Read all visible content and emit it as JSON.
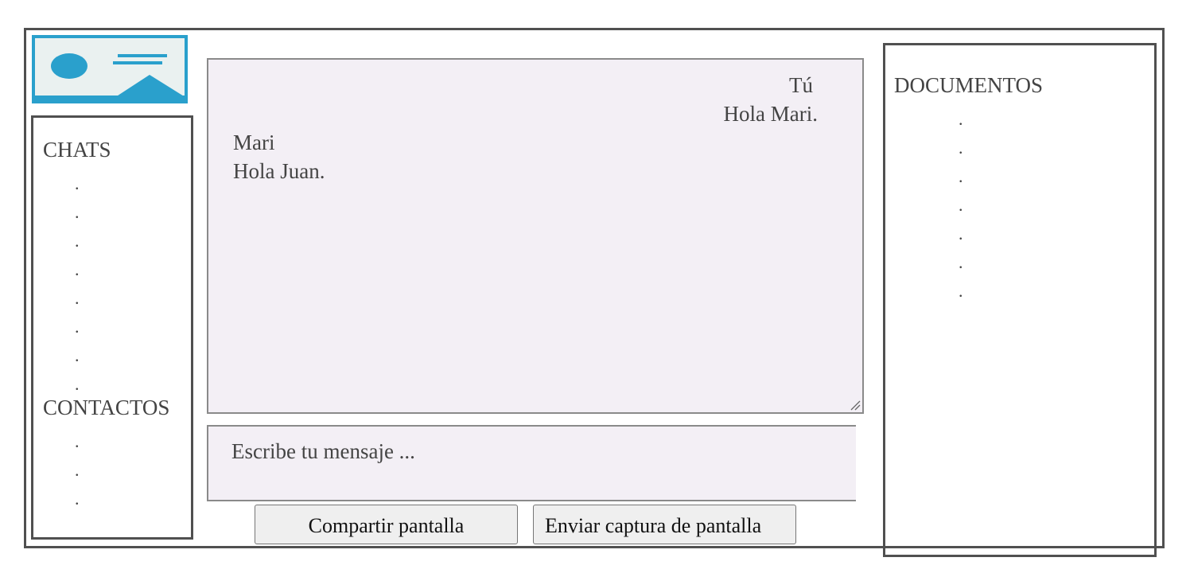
{
  "colors": {
    "border": "#505050",
    "chat_bg": "#f3eff5",
    "logo_blue": "#2aa0cc",
    "logo_bg": "#eaf1f0"
  },
  "logo": {
    "icon": "image-placeholder-icon"
  },
  "sidebar": {
    "chats_title": "CHATS",
    "chat_items": [
      ".",
      ".",
      ".",
      ".",
      ".",
      ".",
      ".",
      "."
    ],
    "contacts_title": "CONTACTOS",
    "contact_items": [
      ".",
      ".",
      "."
    ]
  },
  "chat": {
    "messages": [
      {
        "sender": "Tú",
        "text": "Hola Mari.",
        "align": "right"
      },
      {
        "sender": "Mari",
        "text": "Hola Juan.",
        "align": "left"
      }
    ]
  },
  "composer": {
    "placeholder": "Escribe tu mensaje ..."
  },
  "actions": {
    "share_screen": "Compartir pantalla",
    "send_screenshot": "Enviar captura de pantalla"
  },
  "documents": {
    "title": "DOCUMENTOS",
    "items": [
      ".",
      ".",
      ".",
      ".",
      ".",
      ".",
      "."
    ]
  }
}
